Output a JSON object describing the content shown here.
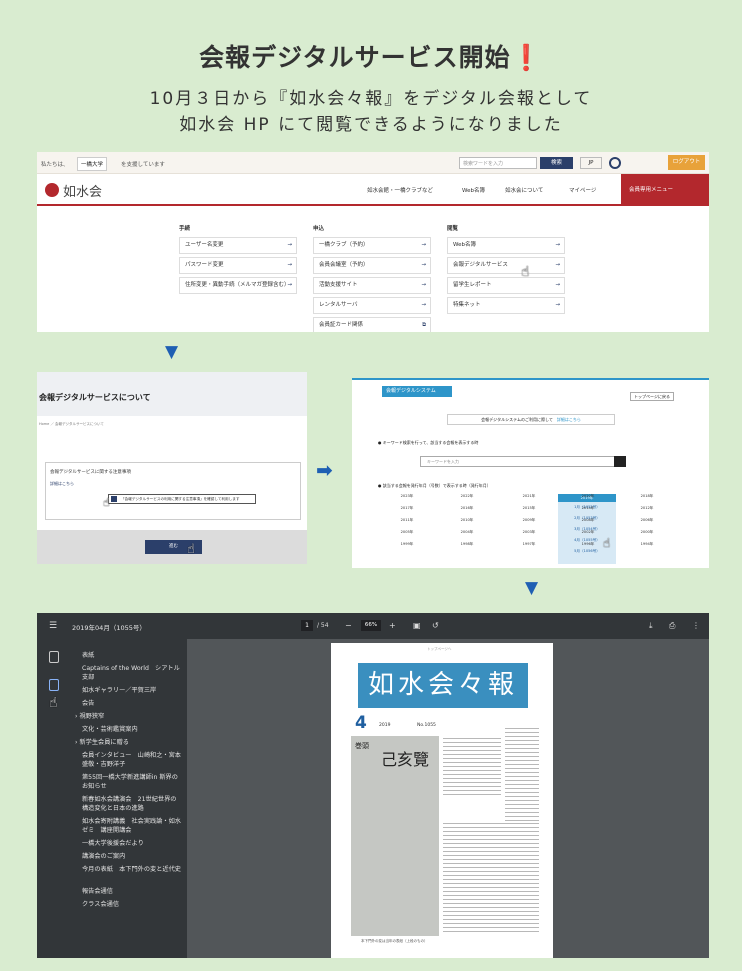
{
  "title": "会報デジタルサービス開始",
  "subtitle_line1": "10月３日から『如水会々報』をデジタル会報として",
  "subtitle_line2": "如水会 HP にて閲覧できるようになりました",
  "panel1": {
    "greeting": "私たちは、",
    "university": "一橋大学",
    "support": "を支援しています",
    "search_placeholder": "検索ワードを入力",
    "search_button": "検索",
    "lang": "JP",
    "logout": "ログアウト",
    "logo": "如水会",
    "nav": [
      "如水会館・一橋クラブなど",
      "Web名簿",
      "如水会について"
    ],
    "mypage": "マイページ",
    "menu": "会員専用メニュー",
    "columns": [
      {
        "head": "手続",
        "items": [
          "ユーザー名変更",
          "パスワード変更",
          "住所変更・異動手続（メルマガ登録含む）"
        ]
      },
      {
        "head": "申込",
        "items": [
          "一橋クラブ（予約）",
          "会員会議室（予約）",
          "活動支援サイト",
          "レンタルサーバ",
          "会員証カード関係"
        ]
      },
      {
        "head": "閲覧",
        "items": [
          "Web名簿",
          "会報デジタルサービス",
          "留学生レポート",
          "特集ネット"
        ]
      }
    ]
  },
  "panel2": {
    "heading": "会報デジタルサービスについて",
    "breadcrumb": "Home ／ 会報デジタルサービスについて",
    "box_heading": "会報デジタルサービスに関する注意事項",
    "box_link": "詳細はこちら",
    "checkbox_label": "「会報デジタルサービスの利用に関する注意事項」を確認して利用します",
    "button": "進む"
  },
  "panel3": {
    "title": "会報デジタルシステム",
    "back": "トップページに戻る",
    "notice": "会報デジタルシステムのご利用に際して",
    "notice_link": "詳細はこちら",
    "section1": "● キーワード検索を行って、該当する会報を表示する時",
    "keyword_placeholder": "キーワードを入力",
    "section2": "● 該当する会報を発行年月（号数）で表示する時（発行年月）",
    "years": [
      [
        "2023年",
        "2022年",
        "2021年",
        "2020年",
        "2019年",
        "2018年"
      ],
      [
        "2017年",
        "2016年",
        "2015年",
        "2014年",
        "2013年",
        "2012年"
      ],
      [
        "2011年",
        "2010年",
        "2009年",
        "2008年",
        "2007年",
        "2006年"
      ],
      [
        "2005年",
        "2004年",
        "2003年",
        "2002年",
        "2001年",
        "2000年"
      ],
      [
        "1999年",
        "1998年",
        "1997年",
        "1996年",
        "1995年",
        "1994年"
      ]
    ],
    "selected_year": "2019年",
    "months": [
      "1月（1052号）",
      "2月（1053号）",
      "3月（1054号）",
      "4月（1055号）",
      "5月（1056号）"
    ]
  },
  "panel4": {
    "filename": "2019年04月（1055号）",
    "page": "1",
    "page_total": "/ 54",
    "zoom": "66%",
    "toc": [
      "表紙",
      "Captains of the World　シアトル支部",
      "如水ギャラリー／平賀三岸",
      "会告",
      "視野狭窄",
      "文化・芸術鑑賞案内",
      "新学生会員に贈る",
      "会員インタビュー　山崎和之・宮本盛敬・吉野洋子",
      "第55回一橋大学新進講師in 斯界のお知らせ",
      "新春如水会講演会　21世紀世界の構造変化と日本の進路",
      "如水会寄附講義　社会実践論・如水ゼミ　講座開講会",
      "一橋大学後援会だより",
      "講演会のご案内",
      "今月の表紙　本下門外の変と近代史",
      "報告会通信",
      "クラス会通信"
    ],
    "toc_indent": [
      false,
      false,
      false,
      false,
      true,
      false,
      true,
      false,
      false,
      false,
      false,
      false,
      false,
      false,
      false,
      false
    ],
    "masthead": "如水会々報",
    "issue_number": "4",
    "issue_year": "2019",
    "issue_no": "No.1055",
    "cover_caption": "己亥覽",
    "cover_side": "巻頭",
    "cover_note": "本下門外の変は当年の表紙（上段のもの）",
    "page_tag": "トップページへ"
  }
}
